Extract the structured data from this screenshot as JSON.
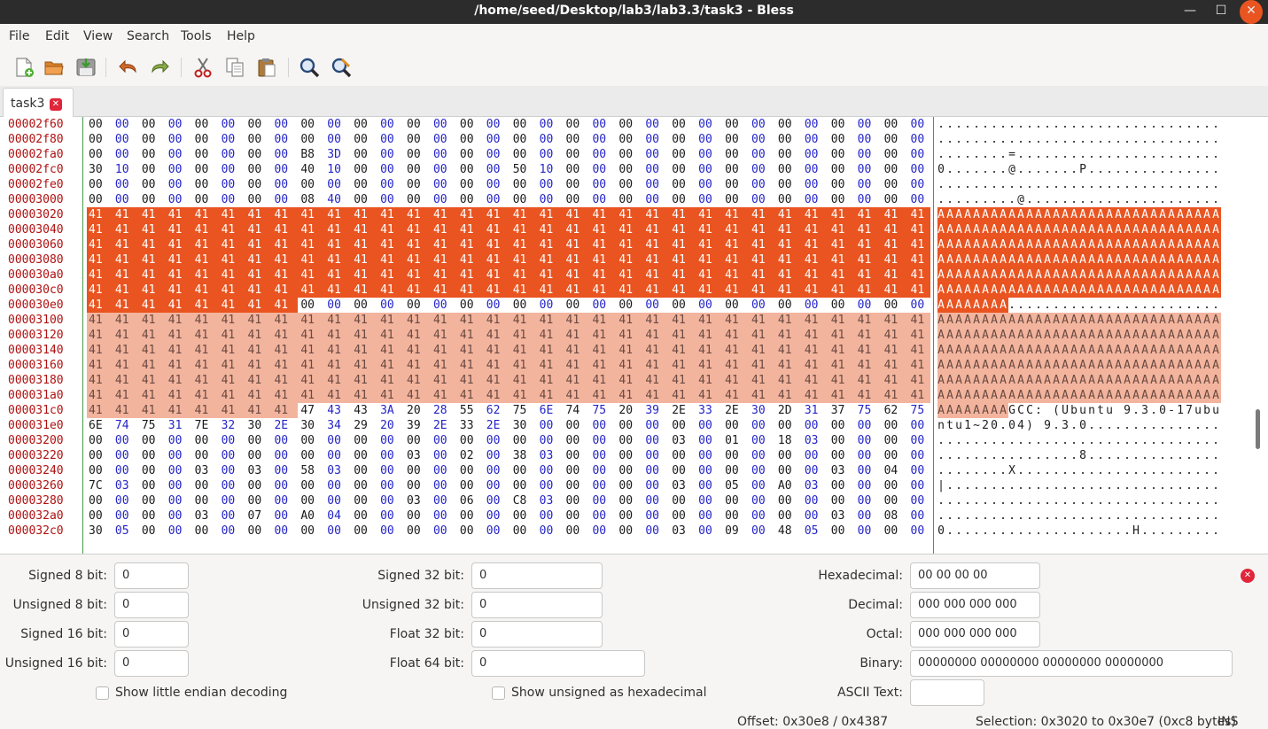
{
  "window": {
    "title": "/home/seed/Desktop/lab3/lab3.3/task3 - Bless"
  },
  "menu": [
    "File",
    "Edit",
    "View",
    "Search",
    "Tools",
    "Help"
  ],
  "toolbar": {
    "icons": [
      "new-file-icon",
      "open-folder-icon",
      "save-icon",
      "undo-icon",
      "redo-icon",
      "cut-icon",
      "copy-icon",
      "paste-icon",
      "find-icon",
      "find-replace-icon"
    ]
  },
  "tabs": [
    {
      "label": "task3",
      "active": true
    }
  ],
  "hexview": {
    "rows": [
      {
        "offset": "00002f60",
        "bytes": "00 00 00 00 00 00 00 00 00 00 00 00 00 00 00 00 00 00 00 00 00 00 00 00 00 00 00 00 00 00 00 00",
        "ascii": "................................"
      },
      {
        "offset": "00002f80",
        "bytes": "00 00 00 00 00 00 00 00 00 00 00 00 00 00 00 00 00 00 00 00 00 00 00 00 00 00 00 00 00 00 00 00",
        "ascii": "................................"
      },
      {
        "offset": "00002fa0",
        "bytes": "00 00 00 00 00 00 00 00 B8 3D 00 00 00 00 00 00 00 00 00 00 00 00 00 00 00 00 00 00 00 00 00 00",
        "ascii": "........=......................."
      },
      {
        "offset": "00002fc0",
        "bytes": "30 10 00 00 00 00 00 00 40 10 00 00 00 00 00 00 50 10 00 00 00 00 00 00 00 00 00 00 00 00 00 00",
        "ascii": "0.......@.......P..............."
      },
      {
        "offset": "00002fe0",
        "bytes": "00 00 00 00 00 00 00 00 00 00 00 00 00 00 00 00 00 00 00 00 00 00 00 00 00 00 00 00 00 00 00 00",
        "ascii": "................................"
      },
      {
        "offset": "00003000",
        "bytes": "00 00 00 00 00 00 00 00 08 40 00 00 00 00 00 00 00 00 00 00 00 00 00 00 00 00 00 00 00 00 00 00",
        "ascii": ".........@......................"
      },
      {
        "offset": "00003020",
        "bytes": "41 41 41 41 41 41 41 41 41 41 41 41 41 41 41 41 41 41 41 41 41 41 41 41 41 41 41 41 41 41 41 41",
        "ascii": "AAAAAAAAAAAAAAAAAAAAAAAAAAAAAAAA"
      },
      {
        "offset": "00003040",
        "bytes": "41 41 41 41 41 41 41 41 41 41 41 41 41 41 41 41 41 41 41 41 41 41 41 41 41 41 41 41 41 41 41 41",
        "ascii": "AAAAAAAAAAAAAAAAAAAAAAAAAAAAAAAA"
      },
      {
        "offset": "00003060",
        "bytes": "41 41 41 41 41 41 41 41 41 41 41 41 41 41 41 41 41 41 41 41 41 41 41 41 41 41 41 41 41 41 41 41",
        "ascii": "AAAAAAAAAAAAAAAAAAAAAAAAAAAAAAAA"
      },
      {
        "offset": "00003080",
        "bytes": "41 41 41 41 41 41 41 41 41 41 41 41 41 41 41 41 41 41 41 41 41 41 41 41 41 41 41 41 41 41 41 41",
        "ascii": "AAAAAAAAAAAAAAAAAAAAAAAAAAAAAAAA"
      },
      {
        "offset": "000030a0",
        "bytes": "41 41 41 41 41 41 41 41 41 41 41 41 41 41 41 41 41 41 41 41 41 41 41 41 41 41 41 41 41 41 41 41",
        "ascii": "AAAAAAAAAAAAAAAAAAAAAAAAAAAAAAAA"
      },
      {
        "offset": "000030c0",
        "bytes": "41 41 41 41 41 41 41 41 41 41 41 41 41 41 41 41 41 41 41 41 41 41 41 41 41 41 41 41 41 41 41 41",
        "ascii": "AAAAAAAAAAAAAAAAAAAAAAAAAAAAAAAA"
      },
      {
        "offset": "000030e0",
        "bytes": "41 41 41 41 41 41 41 41 00 00 00 00 00 00 00 00 00 00 00 00 00 00 00 00 00 00 00 00 00 00 00 00",
        "ascii": "AAAAAAAA........................"
      },
      {
        "offset": "00003100",
        "bytes": "41 41 41 41 41 41 41 41 41 41 41 41 41 41 41 41 41 41 41 41 41 41 41 41 41 41 41 41 41 41 41 41",
        "ascii": "AAAAAAAAAAAAAAAAAAAAAAAAAAAAAAAA"
      },
      {
        "offset": "00003120",
        "bytes": "41 41 41 41 41 41 41 41 41 41 41 41 41 41 41 41 41 41 41 41 41 41 41 41 41 41 41 41 41 41 41 41",
        "ascii": "AAAAAAAAAAAAAAAAAAAAAAAAAAAAAAAA"
      },
      {
        "offset": "00003140",
        "bytes": "41 41 41 41 41 41 41 41 41 41 41 41 41 41 41 41 41 41 41 41 41 41 41 41 41 41 41 41 41 41 41 41",
        "ascii": "AAAAAAAAAAAAAAAAAAAAAAAAAAAAAAAA"
      },
      {
        "offset": "00003160",
        "bytes": "41 41 41 41 41 41 41 41 41 41 41 41 41 41 41 41 41 41 41 41 41 41 41 41 41 41 41 41 41 41 41 41",
        "ascii": "AAAAAAAAAAAAAAAAAAAAAAAAAAAAAAAA"
      },
      {
        "offset": "00003180",
        "bytes": "41 41 41 41 41 41 41 41 41 41 41 41 41 41 41 41 41 41 41 41 41 41 41 41 41 41 41 41 41 41 41 41",
        "ascii": "AAAAAAAAAAAAAAAAAAAAAAAAAAAAAAAA"
      },
      {
        "offset": "000031a0",
        "bytes": "41 41 41 41 41 41 41 41 41 41 41 41 41 41 41 41 41 41 41 41 41 41 41 41 41 41 41 41 41 41 41 41",
        "ascii": "AAAAAAAAAAAAAAAAAAAAAAAAAAAAAAAA"
      },
      {
        "offset": "000031c0",
        "bytes": "41 41 41 41 41 41 41 41 47 43 43 3A 20 28 55 62 75 6E 74 75 20 39 2E 33 2E 30 2D 31 37 75 62 75",
        "ascii": "AAAAAAAAGCC: (Ubuntu 9.3.0-17ubu"
      },
      {
        "offset": "000031e0",
        "bytes": "6E 74 75 31 7E 32 30 2E 30 34 29 20 39 2E 33 2E 30 00 00 00 00 00 00 00 00 00 00 00 00 00 00 00",
        "ascii": "ntu1~20.04) 9.3.0..............."
      },
      {
        "offset": "00003200",
        "bytes": "00 00 00 00 00 00 00 00 00 00 00 00 00 00 00 00 00 00 00 00 00 00 03 00 01 00 18 03 00 00 00 00",
        "ascii": "................................"
      },
      {
        "offset": "00003220",
        "bytes": "00 00 00 00 00 00 00 00 00 00 00 00 03 00 02 00 38 03 00 00 00 00 00 00 00 00 00 00 00 00 00 00",
        "ascii": "................8..............."
      },
      {
        "offset": "00003240",
        "bytes": "00 00 00 00 03 00 03 00 58 03 00 00 00 00 00 00 00 00 00 00 00 00 00 00 00 00 00 00 03 00 04 00",
        "ascii": "........X......................."
      },
      {
        "offset": "00003260",
        "bytes": "7C 03 00 00 00 00 00 00 00 00 00 00 00 00 00 00 00 00 00 00 00 00 03 00 05 00 A0 03 00 00 00 00",
        "ascii": "|..............................."
      },
      {
        "offset": "00003280",
        "bytes": "00 00 00 00 00 00 00 00 00 00 00 00 03 00 06 00 C8 03 00 00 00 00 00 00 00 00 00 00 00 00 00 00",
        "ascii": "................................"
      },
      {
        "offset": "000032a0",
        "bytes": "00 00 00 00 03 00 07 00 A0 04 00 00 00 00 00 00 00 00 00 00 00 00 00 00 00 00 00 00 03 00 08 00",
        "ascii": "................................"
      },
      {
        "offset": "000032c0",
        "bytes": "30 05 00 00 00 00 00 00 00 00 00 00 00 00 00 00 00 00 00 00 00 00 03 00 09 00 48 05 00 00 00 00",
        "ascii": "0.....................H........."
      }
    ]
  },
  "panel": {
    "left_labels": [
      "Signed 8 bit:",
      "Unsigned 8 bit:",
      "Signed 16 bit:",
      "Unsigned 16 bit:"
    ],
    "left_values": [
      "0",
      "0",
      "0",
      "0"
    ],
    "mid_labels": [
      "Signed 32 bit:",
      "Unsigned 32 bit:",
      "Float 32 bit:",
      "Float 64 bit:"
    ],
    "mid_values": [
      "0",
      "0",
      "0",
      "0"
    ],
    "right_labels": [
      "Hexadecimal:",
      "Decimal:",
      "Octal:",
      "Binary:",
      "ASCII Text:"
    ],
    "right_values": [
      "00 00 00 00",
      "000 000 000 000",
      "000 000 000 000",
      "00000000 00000000 00000000 00000000",
      ""
    ],
    "little_endian_label": "Show little endian decoding",
    "unsigned_hex_label": "Show unsigned as hexadecimal"
  },
  "status": {
    "offset": "Offset: 0x30e8 / 0x4387",
    "selection": "Selection: 0x3020 to 0x30e7 (0xc8 bytes)",
    "mode": "INS"
  },
  "colors": {
    "selection_primary": "#e95420",
    "selection_secondary": "#f3b49e",
    "offset_text": "#b01010",
    "alt_byte": "#2424c8"
  }
}
